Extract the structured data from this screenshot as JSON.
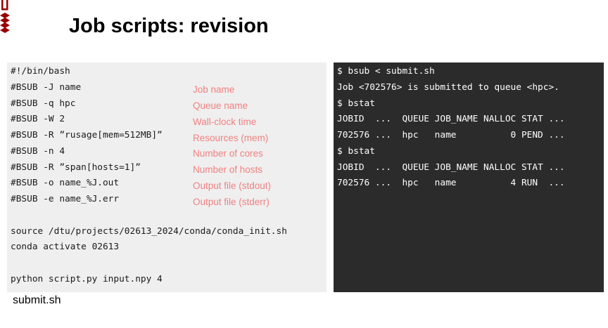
{
  "slide": {
    "title": "Job scripts: revision",
    "caption": "submit.sh"
  },
  "logo": {
    "icon": "dtu-logo-icon",
    "color": "#990000"
  },
  "script": {
    "lines": [
      "#!/bin/bash",
      "#BSUB -J name",
      "#BSUB -q hpc",
      "#BSUB -W 2",
      "#BSUB -R ”rusage[mem=512MB]”",
      "#BSUB -n 4",
      "#BSUB -R ”span[hosts=1]”",
      "#BSUB -o name_%J.out",
      "#BSUB -e name_%J.err",
      "",
      "source /dtu/projects/02613_2024/conda/conda_init.sh",
      "conda activate 02613",
      "",
      "python script.py input.npy 4"
    ],
    "comments": [
      "Job name",
      "Queue name",
      "Wall-clock time",
      "Resources (mem)",
      "Number of cores",
      "Number of hosts",
      "Output file (stdout)",
      "Output file (stderr)"
    ],
    "comment_color": "#f08080",
    "background": "#efefef"
  },
  "terminal": {
    "lines": [
      "$ bsub < submit.sh",
      "Job <702576> is submitted to queue <hpc>.",
      "$ bstat",
      "JOBID  ...  QUEUE JOB_NAME NALLOC STAT ...",
      "702576 ...  hpc   name          0 PEND ...",
      "$ bstat",
      "JOBID  ...  QUEUE JOB_NAME NALLOC STAT ...",
      "702576 ...  hpc   name          4 RUN  ..."
    ],
    "background": "#2b2b2b"
  }
}
